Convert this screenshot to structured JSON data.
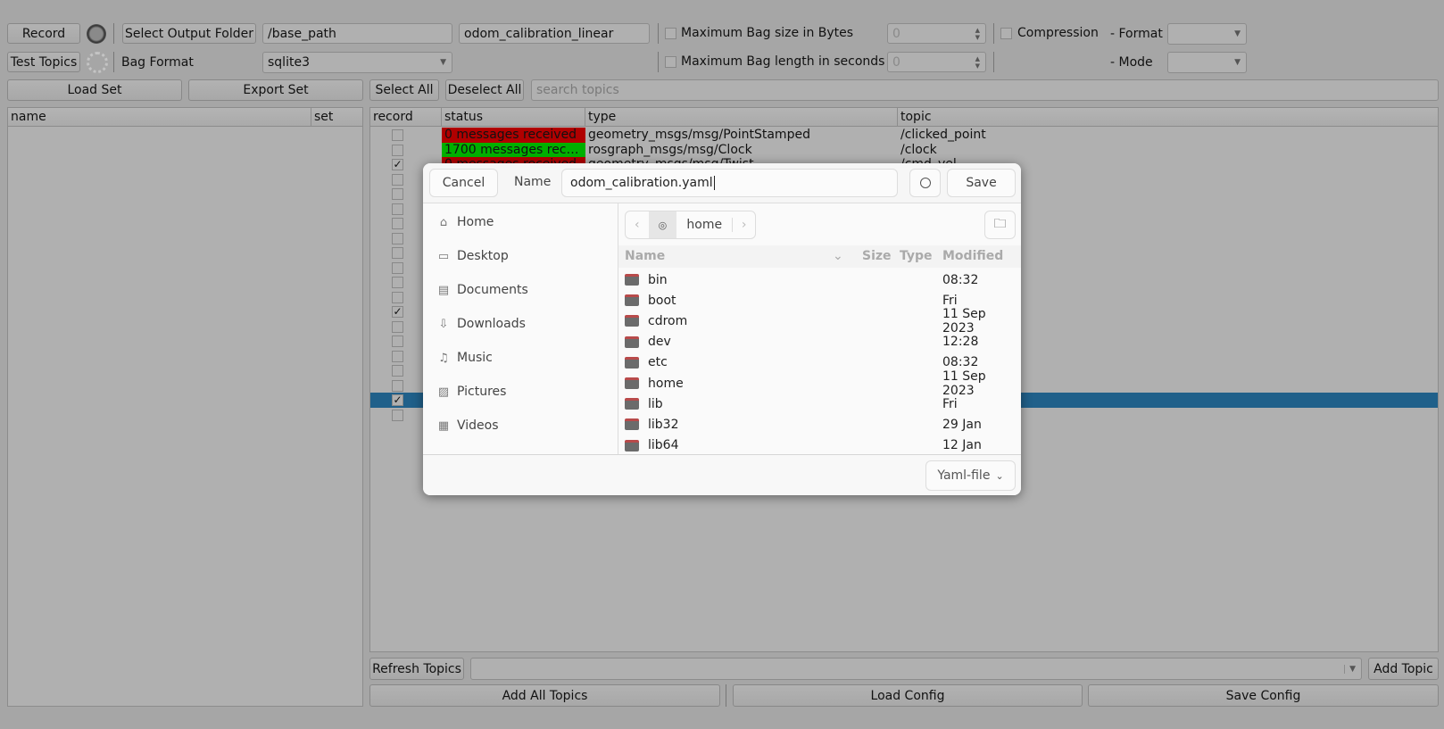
{
  "toolbar": {
    "record": "Record",
    "select_output_folder": "Select Output Folder",
    "output_path": "/base_path",
    "bag_name": "odom_calibration_linear",
    "max_size_label": "Maximum Bag size in Bytes",
    "max_size_value": "0",
    "max_size_checked": false,
    "compression_label": "Compression",
    "compression_checked": false,
    "format_label": "- Format",
    "format_value": "",
    "test_topics": "Test Topics",
    "bag_format_label": "Bag Format",
    "bag_format_value": "sqlite3",
    "max_length_label": "Maximum Bag length in seconds",
    "max_length_value": "0",
    "max_length_checked": false,
    "mode_label": "- Mode",
    "mode_value": "",
    "load_set": "Load Set",
    "export_set": "Export Set",
    "select_all": "Select All",
    "deselect_all": "Deselect All",
    "search_placeholder": "search topics"
  },
  "sets_table": {
    "columns": [
      "name",
      "set"
    ]
  },
  "topics_table": {
    "columns": [
      "record",
      "status",
      "type",
      "topic"
    ],
    "status_colors": {
      "red": "#b00000",
      "green": "#00b000"
    },
    "selection_color": "#20608a",
    "rows": [
      {
        "checked": false,
        "status": "0 messages received",
        "status_color": "red",
        "type": "geometry_msgs/msg/PointStamped",
        "topic": "/clicked_point"
      },
      {
        "checked": false,
        "status": "1700 messages rece...",
        "status_color": "green",
        "type": "rosgraph_msgs/msg/Clock",
        "topic": "/clock"
      },
      {
        "checked": true,
        "status": "0 messages received",
        "status_color": "red",
        "type": "geometry_msgs/msg/Twist",
        "topic": "/cmd_vel"
      },
      {
        "checked": false
      },
      {
        "checked": false
      },
      {
        "checked": false
      },
      {
        "checked": false
      },
      {
        "checked": false
      },
      {
        "checked": false
      },
      {
        "checked": false
      },
      {
        "checked": false
      },
      {
        "checked": false
      },
      {
        "checked": true
      },
      {
        "checked": false
      },
      {
        "checked": false
      },
      {
        "checked": false
      },
      {
        "checked": false
      },
      {
        "checked": false
      },
      {
        "checked": true,
        "selected": true
      },
      {
        "checked": false
      }
    ]
  },
  "bottom": {
    "refresh_topics": "Refresh Topics",
    "topic_combo": "",
    "add_topic": "Add Topic",
    "add_all_topics": "Add All Topics",
    "load_config": "Load Config",
    "save_config": "Save Config"
  },
  "dialog": {
    "cancel": "Cancel",
    "name_label": "Name",
    "filename": "odom_calibration.yaml",
    "save": "Save",
    "places": [
      {
        "label": "Home",
        "icon": "home-icon"
      },
      {
        "label": "Desktop",
        "icon": "desktop-icon"
      },
      {
        "label": "Documents",
        "icon": "document-icon"
      },
      {
        "label": "Downloads",
        "icon": "download-icon"
      },
      {
        "label": "Music",
        "icon": "music-icon"
      },
      {
        "label": "Pictures",
        "icon": "picture-icon"
      },
      {
        "label": "Videos",
        "icon": "video-icon"
      }
    ],
    "path": "home",
    "columns": {
      "name": "Name",
      "size": "Size",
      "type": "Type",
      "modified": "Modified"
    },
    "files": [
      {
        "name": "bin",
        "modified": "08:32"
      },
      {
        "name": "boot",
        "modified": "Fri"
      },
      {
        "name": "cdrom",
        "modified": "11 Sep 2023"
      },
      {
        "name": "dev",
        "modified": "12:28"
      },
      {
        "name": "etc",
        "modified": "08:32"
      },
      {
        "name": "home",
        "modified": "11 Sep 2023"
      },
      {
        "name": "lib",
        "modified": "Fri"
      },
      {
        "name": "lib32",
        "modified": "29 Jan"
      },
      {
        "name": "lib64",
        "modified": "12 Jan"
      }
    ],
    "filter": "Yaml-file"
  }
}
